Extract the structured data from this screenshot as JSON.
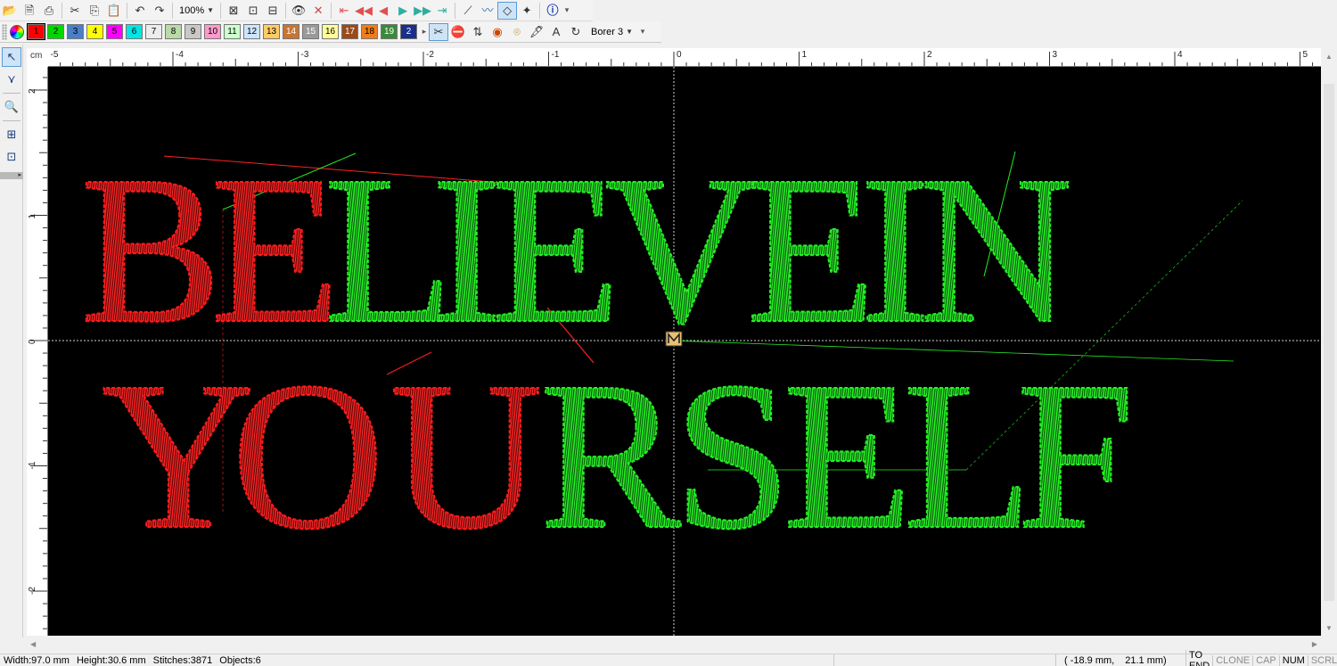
{
  "toolbar_main": {
    "zoom": "100%",
    "buttons": [
      "open-folder-icon",
      "open-file-icon",
      "print-icon",
      "cut-icon",
      "copy-icon",
      "paste-icon",
      "undo-icon",
      "redo-icon",
      "fit-page-icon",
      "fit-selection-icon",
      "fit-width-icon",
      "show-icon",
      "hide-icon",
      "stitch-first-icon",
      "stitch-back-100-icon",
      "stitch-back-10-icon",
      "stitch-back-1-icon",
      "stitch-fwd-1-icon",
      "stitch-fwd-10-icon",
      "stitch-last-icon",
      "tie-icon",
      "travel-icon",
      "select-mode-icon",
      "wand-icon",
      "info-icon"
    ]
  },
  "toolbar_colors": {
    "swatches": [
      {
        "label": "1",
        "color": "#ff0000"
      },
      {
        "label": "2",
        "color": "#00d800"
      },
      {
        "label": "3",
        "color": "#4a7fc8"
      },
      {
        "label": "4",
        "color": "#ffff00"
      },
      {
        "label": "5",
        "color": "#ff00ff"
      },
      {
        "label": "6",
        "color": "#00e5e5"
      },
      {
        "label": "7",
        "color": "#ececec"
      },
      {
        "label": "8",
        "color": "#b9d9a6"
      },
      {
        "label": "9",
        "color": "#c8c8c8"
      },
      {
        "label": "10",
        "color": "#ff99cc"
      },
      {
        "label": "11",
        "color": "#ccffcc"
      },
      {
        "label": "12",
        "color": "#cce5ff"
      },
      {
        "label": "13",
        "color": "#ffcc66"
      },
      {
        "label": "14",
        "color": "#c87532"
      },
      {
        "label": "15",
        "color": "#9a9a9a"
      },
      {
        "label": "16",
        "color": "#ffff99"
      },
      {
        "label": "17",
        "color": "#9a4a1a"
      },
      {
        "label": "18",
        "color": "#f07d18"
      },
      {
        "label": "19",
        "color": "#3a8a3a"
      },
      {
        "label": "2",
        "color": "#1a2f8a"
      }
    ],
    "tools": [
      "scissors-icon",
      "stop-icon",
      "jump-icon",
      "trim-icon",
      "needle-icon",
      "pen-icon",
      "text-icon",
      "rotate-icon"
    ],
    "borer_label": "Borer 3"
  },
  "ruler": {
    "unit": "cm",
    "top_labels": [
      "-5",
      "-4",
      "-3",
      "-2",
      "-1",
      "0",
      "1",
      "2",
      "3",
      "4",
      "5"
    ],
    "left_labels": [
      "2",
      "1",
      "0",
      "-1",
      "-2"
    ]
  },
  "design": {
    "line1": [
      {
        "char": "B",
        "color": "#ff1a1a"
      },
      {
        "char": "E",
        "color": "#ff1a1a"
      },
      {
        "char": "L",
        "color": "#22ee22"
      },
      {
        "char": "I",
        "color": "#22ee22"
      },
      {
        "char": "E",
        "color": "#22ee22"
      },
      {
        "char": "V",
        "color": "#22ee22"
      },
      {
        "char": "E",
        "color": "#22ee22"
      },
      {
        "char": "I",
        "color": "#22ee22"
      },
      {
        "char": "N",
        "color": "#22ee22"
      }
    ],
    "line2": [
      {
        "char": "Y",
        "color": "#ff1a1a"
      },
      {
        "char": "O",
        "color": "#ff1a1a"
      },
      {
        "char": "U",
        "color": "#ff1a1a"
      },
      {
        "char": "R",
        "color": "#22ee22"
      },
      {
        "char": "S",
        "color": "#22ee22"
      },
      {
        "char": "E",
        "color": "#22ee22"
      },
      {
        "char": "L",
        "color": "#22ee22"
      },
      {
        "char": "F",
        "color": "#22ee22"
      }
    ]
  },
  "status": {
    "width": "Width:97.0 mm",
    "height": "Height:30.6 mm",
    "stitches": "Stitches:3871",
    "objects": "Objects:6",
    "coords": "( -18.9 mm,",
    "coords2": "21.1 mm)",
    "flags": [
      {
        "label": "TO END",
        "active": true
      },
      {
        "label": "CLONE",
        "active": false
      },
      {
        "label": "CAP",
        "active": false
      },
      {
        "label": "NUM",
        "active": true
      },
      {
        "label": "SCRL",
        "active": false
      }
    ]
  }
}
